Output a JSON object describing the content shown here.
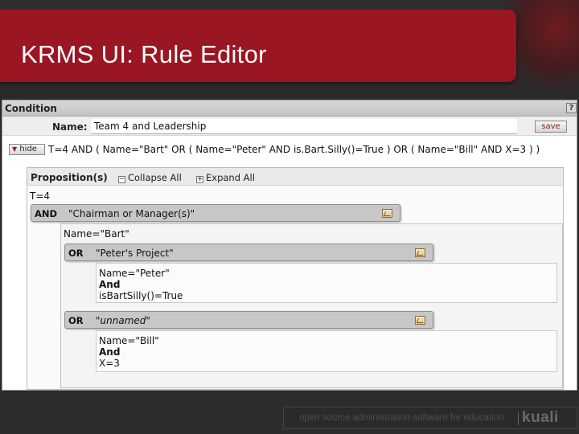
{
  "slide": {
    "title": "KRMS UI: Rule Editor",
    "footer_tagline": "open source administration software for education",
    "logo_text": "kuali"
  },
  "condition": {
    "header": "Condition",
    "help_glyph": "?",
    "name_label": "Name:",
    "name_value": "Team 4 and Leadership",
    "save_label": "save",
    "hide_label": "hide",
    "expression": "T=4 AND ( Name=\"Bart\" OR ( Name=\"Peter\" AND is.Bart.Silly()=True ) OR ( Name=\"Bill\" AND X=3 ) )"
  },
  "propositions": {
    "title": "Proposition(s)",
    "collapse_all": "Collapse All",
    "expand_all": "Expand All",
    "root_leaf": "T=4",
    "group_main": {
      "operator": "AND",
      "label": "\"Chairman or Manager(s)\""
    },
    "main_leaf": "Name=\"Bart\"",
    "group_peter": {
      "operator": "OR",
      "label": "\"Peter's Project\"",
      "lines": [
        "Name=\"Peter\"",
        "And",
        "isBartSilly()=True"
      ]
    },
    "group_unnamed": {
      "operator": "OR",
      "label": "\"unnamed\"",
      "lines": [
        "Name=\"Bill\"",
        "And",
        "X=3"
      ]
    }
  },
  "colors": {
    "banner": "#9a1622",
    "background": "#2b2a2a",
    "group_bar": "#c7c7c7"
  }
}
